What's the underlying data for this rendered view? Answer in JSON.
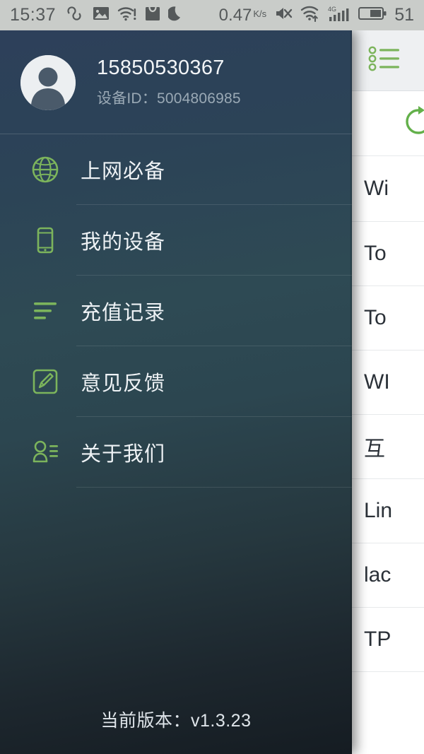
{
  "status_bar": {
    "time": "15:37",
    "left_icons": [
      "infinity-icon",
      "image-icon",
      "wifi-alert-icon",
      "bag-icon",
      "moon-icon"
    ],
    "data_rate": "0.47",
    "data_rate_unit": "K/s",
    "right_icons": [
      "mute-icon",
      "wifi-upload-icon",
      "signal-4g-icon",
      "battery-icon"
    ],
    "battery_level": "51",
    "background_color": "#c9ccc9",
    "text_color": "#55595a"
  },
  "drawer": {
    "profile": {
      "avatar": "user-avatar-icon",
      "phone_number": "15850530367",
      "device_id_label": "设备ID：",
      "device_id_value": "5004806985",
      "device_id_full": "设备ID：5004806985"
    },
    "menu_items": [
      {
        "icon": "globe-icon",
        "label": "上网必备"
      },
      {
        "icon": "device-icon",
        "label": "我的设备"
      },
      {
        "icon": "list-icon",
        "label": "充值记录"
      },
      {
        "icon": "edit-icon",
        "label": "意见反馈"
      },
      {
        "icon": "about-icon",
        "label": "关于我们"
      }
    ],
    "version_text": "当前版本：v1.3.23",
    "accent_color": "#7cb45c",
    "text_color": "#eef2f5",
    "sub_text_color": "#9aa9b5"
  },
  "content_panel": {
    "header_icon": "list-menu-icon",
    "refresh_icon": "refresh-icon",
    "wifi_list": [
      {
        "name": "Wi"
      },
      {
        "name": "To"
      },
      {
        "name": "To"
      },
      {
        "name": "WI"
      },
      {
        "name": "互"
      },
      {
        "name": "Lin"
      },
      {
        "name": "lac"
      },
      {
        "name": "TP"
      }
    ]
  }
}
